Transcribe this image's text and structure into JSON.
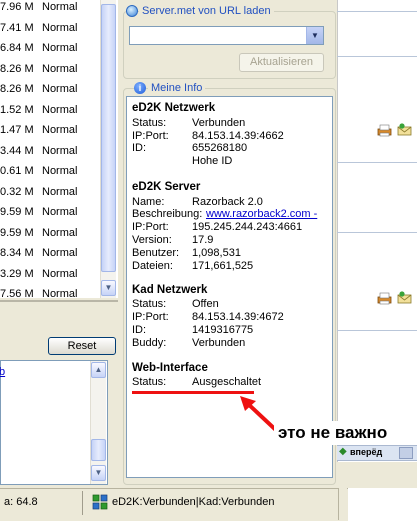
{
  "server_list": {
    "rows": [
      {
        "size": "7.96 M",
        "priority": "Normal"
      },
      {
        "size": "7.41 M",
        "priority": "Normal"
      },
      {
        "size": "6.84 M",
        "priority": "Normal"
      },
      {
        "size": "8.26 M",
        "priority": "Normal"
      },
      {
        "size": "8.26 M",
        "priority": "Normal"
      },
      {
        "size": "1.52 M",
        "priority": "Normal"
      },
      {
        "size": "1.47 M",
        "priority": "Normal"
      },
      {
        "size": "3.44 M",
        "priority": "Normal"
      },
      {
        "size": "0.61 M",
        "priority": "Normal"
      },
      {
        "size": "0.32 M",
        "priority": "Normal"
      },
      {
        "size": "9.59 M",
        "priority": "Normal"
      },
      {
        "size": "9.59 M",
        "priority": "Normal"
      },
      {
        "size": "8.34 M",
        "priority": "Normal"
      },
      {
        "size": "3.29 M",
        "priority": "Normal"
      },
      {
        "size": "7.56 M",
        "priority": "Normal"
      }
    ]
  },
  "buttons": {
    "reset": "Reset",
    "refresh": "Aktualisieren"
  },
  "log": {
    "link_fragment": "b"
  },
  "server_met": {
    "title": "Server.met von URL laden",
    "url_value": ""
  },
  "my_info": {
    "title": "Meine Info",
    "ed2k_network": {
      "title": "eD2K Netzwerk",
      "rows": [
        {
          "label": "Status:",
          "value": "Verbunden"
        },
        {
          "label": "IP:Port:",
          "value": "84.153.14.39:4662"
        },
        {
          "label": "ID:",
          "value": "655268180"
        },
        {
          "label": "",
          "value": "Hohe ID"
        }
      ]
    },
    "ed2k_server": {
      "title": "eD2K Server",
      "rows": [
        {
          "label": "Name:",
          "value": "Razorback 2.0"
        },
        {
          "label": "Beschreibung:",
          "value": "www.razorback2.com -"
        },
        {
          "label": "IP:Port:",
          "value": "195.245.244.243:4661"
        },
        {
          "label": "Version:",
          "value": "17.9"
        },
        {
          "label": "Benutzer:",
          "value": "1,098,531"
        },
        {
          "label": "Dateien:",
          "value": "171,661,525"
        }
      ]
    },
    "kad_network": {
      "title": "Kad Netzwerk",
      "rows": [
        {
          "label": "Status:",
          "value": "Offen"
        },
        {
          "label": "IP:Port:",
          "value": "84.153.14.39:4672"
        },
        {
          "label": "ID:",
          "value": "1419316775"
        },
        {
          "label": "Buddy:",
          "value": "Verbunden"
        }
      ]
    },
    "web_interface": {
      "title": "Web-Interface",
      "rows": [
        {
          "label": "Status:",
          "value": "Ausgeschaltet"
        }
      ]
    }
  },
  "status_bar": {
    "speed": "a: 64.8",
    "connection": "eD2K:Verbunden|Kad:Verbunden"
  },
  "browser_strip": {
    "forward_label": "вперёд"
  },
  "annotation": {
    "text": "это не важно",
    "color": "#ee1111"
  }
}
